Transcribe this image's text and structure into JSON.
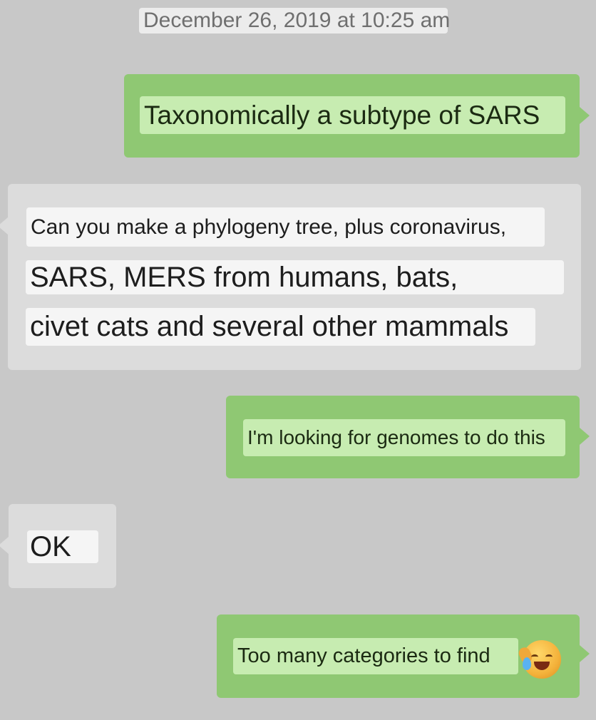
{
  "conversation": {
    "timestamp": "December 26, 2019 at 10:25 am",
    "messages": [
      {
        "direction": "outgoing",
        "lines": [
          "Taxonomically a subtype of SARS"
        ]
      },
      {
        "direction": "incoming",
        "lines": [
          "Can you make a phylogeny tree, plus coronavirus,",
          "SARS, MERS from humans, bats,",
          "civet cats and several other mammals"
        ]
      },
      {
        "direction": "outgoing",
        "lines": [
          "I'm looking for genomes to do this"
        ]
      },
      {
        "direction": "incoming",
        "lines": [
          "OK"
        ]
      },
      {
        "direction": "outgoing",
        "lines": [
          "Too many categories to find"
        ],
        "emoji": "face-with-tears-of-joy-icon"
      }
    ]
  },
  "colors": {
    "background": "#c8c8c8",
    "outgoing_bubble": "#8fc873",
    "incoming_bubble": "#dcdcdc",
    "outgoing_highlight": "#c7ecb1",
    "incoming_highlight": "#f5f5f5",
    "timestamp_text": "#6f6f6f"
  }
}
